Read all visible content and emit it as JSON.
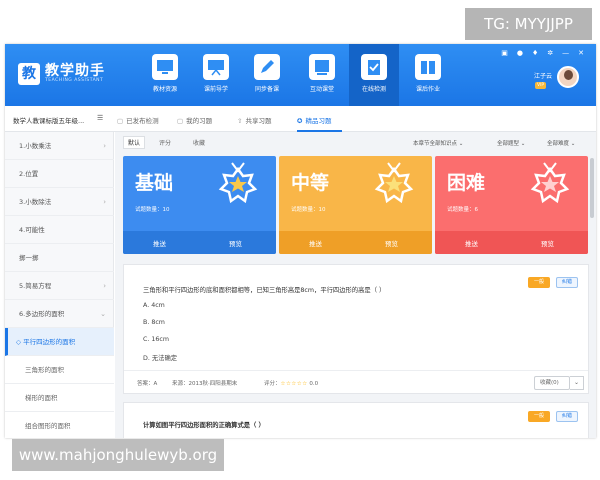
{
  "watermarks": {
    "tg": "TG: MYYJJPP",
    "url": "www.mahjonghulewyb.org"
  },
  "app": {
    "logo_glyph": "教",
    "title": "教学助手",
    "subtitle": "TEACHING ASSISTANT",
    "user_name": "江子云",
    "user_tag": "VIP",
    "window_controls": [
      "chat-icon",
      "bell-icon",
      "tshirt-icon",
      "settings-icon",
      "minimize-icon",
      "close-icon"
    ],
    "colors": {
      "primary": "#1b76e6",
      "easy": "#3d8cf0",
      "medium": "#f9b648",
      "hard": "#fb6e6e"
    }
  },
  "nav": [
    {
      "label": "教材资源",
      "icon": "monitor-icon"
    },
    {
      "label": "课前导学",
      "icon": "presentation-icon"
    },
    {
      "label": "同步备课",
      "icon": "pen-icon"
    },
    {
      "label": "互动课堂",
      "icon": "screen-icon"
    },
    {
      "label": "在线检测",
      "icon": "clipboard-check-icon",
      "active": true
    },
    {
      "label": "课后作业",
      "icon": "homework-icon"
    }
  ],
  "subbar": {
    "book_title": "数学人教课标版五年级...",
    "tabs": [
      "已发布检测",
      "我的习题",
      "共享习题",
      "精品习题"
    ],
    "active_tab": "精品习题"
  },
  "sidebar": {
    "items": [
      {
        "label": "1.小数乘法",
        "chevron": "›"
      },
      {
        "label": "2.位置",
        "chevron": ""
      },
      {
        "label": "3.小数除法",
        "chevron": "›"
      },
      {
        "label": "4.可能性",
        "chevron": ""
      },
      {
        "label": "掷一掷",
        "chevron": ""
      },
      {
        "label": "5.简易方程",
        "chevron": "›"
      },
      {
        "label": "6.多边形的面积",
        "chevron": "⌄"
      },
      {
        "label": "平行四边形的面积",
        "chevron": "",
        "active": true
      },
      {
        "label": "三角形的面积",
        "chevron": "",
        "sub": true
      },
      {
        "label": "梯形的面积",
        "chevron": "",
        "sub": true
      },
      {
        "label": "组合图形的面积",
        "chevron": "",
        "sub": true
      }
    ]
  },
  "filters": {
    "tabs": [
      "默认",
      "评分",
      "收藏"
    ],
    "active": "默认",
    "dropdowns": [
      "本章节全部知识点 ⌄",
      "全部题型 ⌄",
      "全部难度 ⌄"
    ]
  },
  "cards": [
    {
      "title": "基础",
      "count": "试题数量：10",
      "push": "推送",
      "preview": "预览"
    },
    {
      "title": "中等",
      "count": "试题数量：10",
      "push": "推送",
      "preview": "预览"
    },
    {
      "title": "困难",
      "count": "试题数量：6",
      "push": "推送",
      "preview": "预览"
    }
  ],
  "question1": {
    "text": "三角形和平行四边形的底和面积都相等，已知三角形高是8cm，平行四边形的高是（      ）",
    "options": [
      "A. 4cm",
      "B. 8cm",
      "C. 16cm",
      "D. 无法确定"
    ],
    "level": "一般",
    "fix_label": "纠错",
    "answer": "答案：A",
    "source": "来源：2013秋·四阳县期末",
    "score_label": "评分：",
    "stars": "☆☆☆☆☆",
    "score": "0.0",
    "collect": "收藏(0)"
  },
  "question2": {
    "text": "计算如图平行四边形面积的正确算式是（      ）",
    "level": "一般",
    "fix_label": "纠错"
  }
}
